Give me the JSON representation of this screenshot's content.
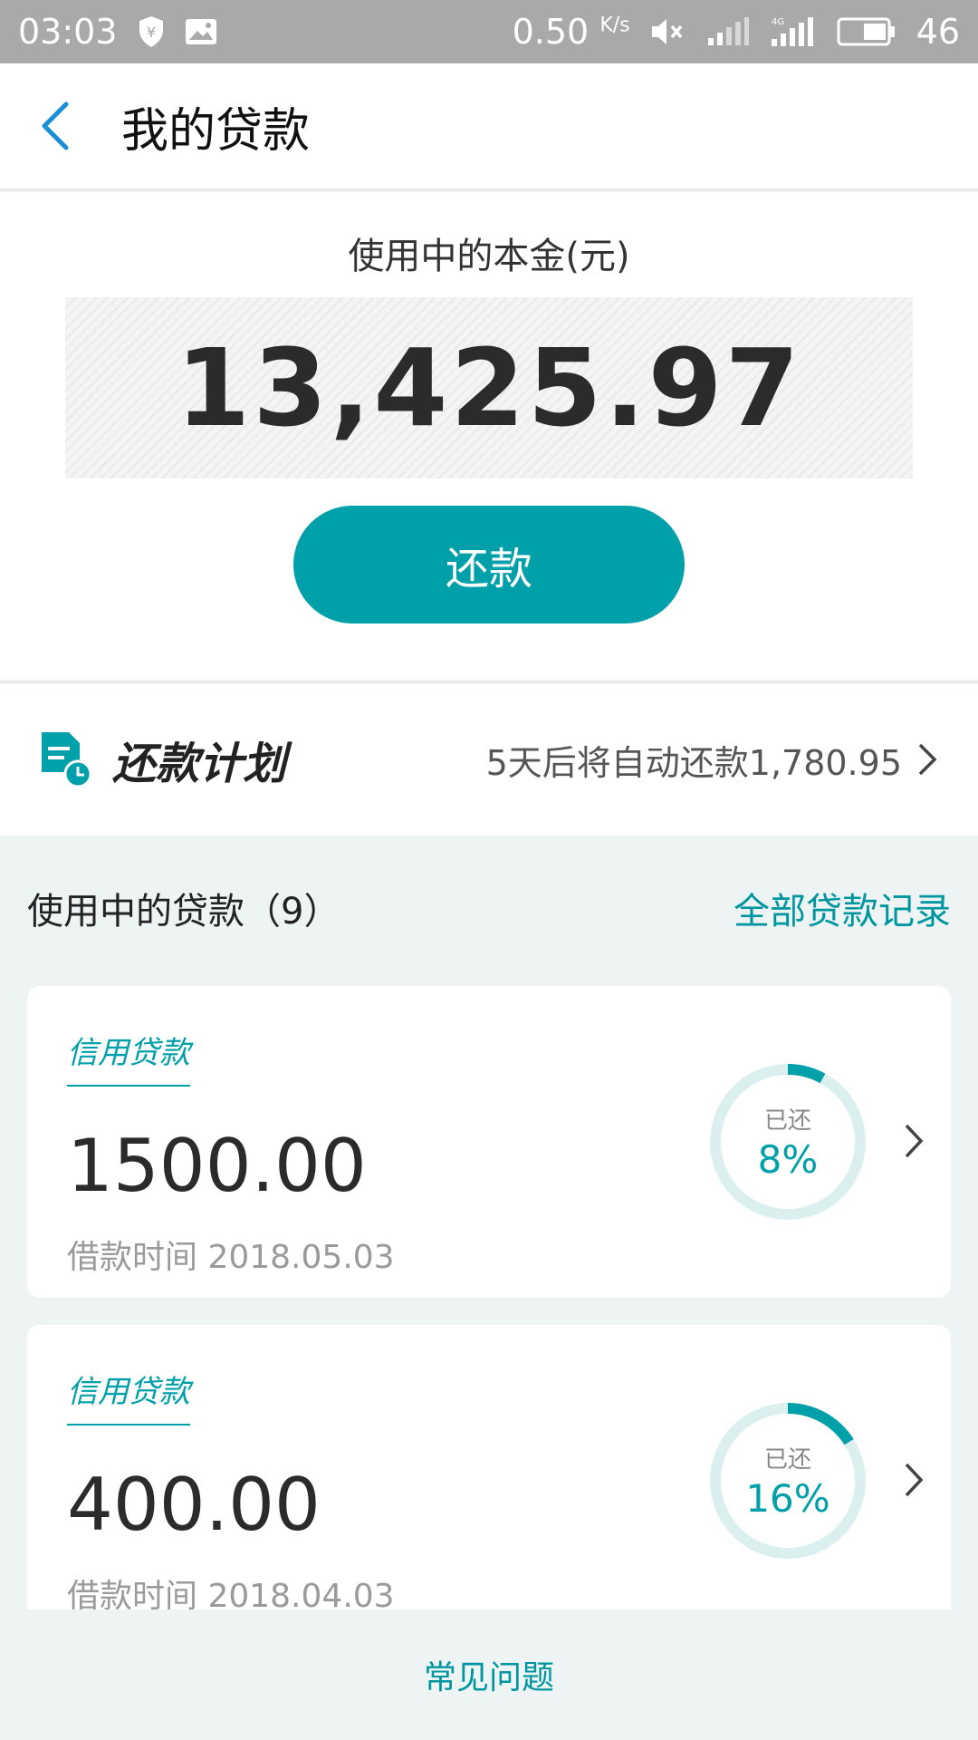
{
  "status_bar": {
    "time": "03:03",
    "speed": "0.50",
    "speed_unit": "K/s",
    "battery": "46"
  },
  "header": {
    "title": "我的贷款"
  },
  "principal": {
    "label": "使用中的本金(元)",
    "amount": "13,425.97",
    "repay_button": "还款"
  },
  "plan": {
    "title": "还款计划",
    "info": "5天后将自动还款1,780.95"
  },
  "loans": {
    "title": "使用中的贷款（9）",
    "all_records": "全部贷款记录",
    "items": [
      {
        "tag": "信用贷款",
        "amount": "1500.00",
        "date": "借款时间 2018.05.03",
        "repaid_label": "已还",
        "repaid_pct": "8%",
        "progress": 0.08
      },
      {
        "tag": "信用贷款",
        "amount": "400.00",
        "date": "借款时间 2018.04.03",
        "repaid_label": "已还",
        "repaid_pct": "16%",
        "progress": 0.16
      }
    ]
  },
  "footer": {
    "faq": "常见问题"
  },
  "colors": {
    "accent": "#00a0aa",
    "ring_track": "#dcefef"
  },
  "icons": {
    "back": "chevron-left-icon",
    "plan": "document-clock-icon",
    "chevron": "chevron-right-icon"
  }
}
